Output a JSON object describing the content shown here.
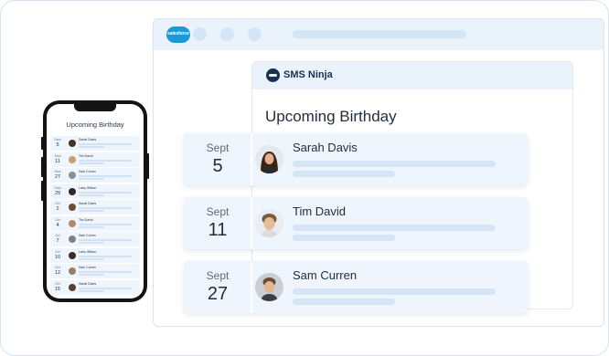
{
  "browser": {
    "logo_text": "salesforce"
  },
  "app": {
    "name": "SMS Ninja",
    "title": "Upcoming Birthday"
  },
  "birthdays": [
    {
      "month": "Sept",
      "day": "5",
      "name": "Sarah Davis"
    },
    {
      "month": "Sept",
      "day": "11",
      "name": "Tim David"
    },
    {
      "month": "Sept",
      "day": "27",
      "name": "Sam Curren"
    }
  ],
  "phone": {
    "title": "Upcoming Birthday",
    "rows": [
      {
        "month": "Sept",
        "day": "5",
        "name": "Sarah Davis"
      },
      {
        "month": "Sept",
        "day": "11",
        "name": "Tim David"
      },
      {
        "month": "Sept",
        "day": "27",
        "name": "Sam Curren"
      },
      {
        "month": "Sept",
        "day": "29",
        "name": "Larry Wilson"
      },
      {
        "month": "Oct",
        "day": "2",
        "name": "Sarah Davis"
      },
      {
        "month": "Oct",
        "day": "4",
        "name": "Tim David"
      },
      {
        "month": "Oct",
        "day": "7",
        "name": "Sam Curren"
      },
      {
        "month": "Oct",
        "day": "10",
        "name": "Larry Wilson"
      },
      {
        "month": "Oct",
        "day": "12",
        "name": "Sam Curren"
      },
      {
        "month": "Oct",
        "day": "15",
        "name": "Sarah Davis"
      }
    ]
  },
  "colors": {
    "accent_light": "#eaf3fc",
    "brand_dark": "#16324f",
    "salesforce_blue": "#1b9ad6"
  }
}
